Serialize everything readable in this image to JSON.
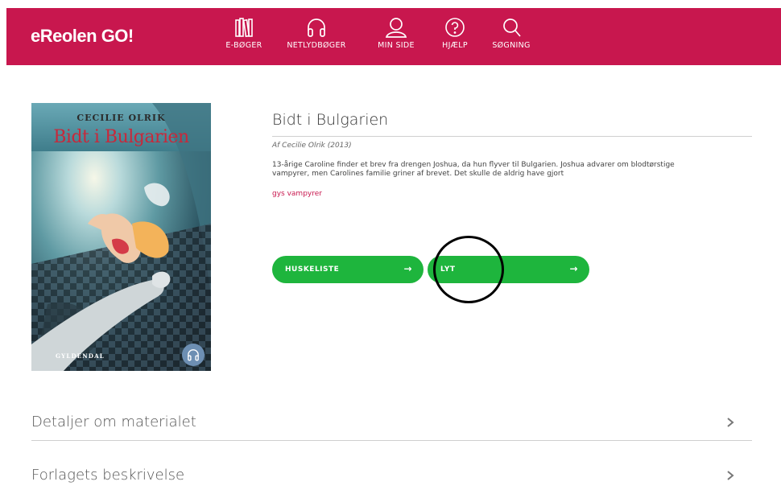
{
  "header": {
    "logo": "eReolen GO!",
    "brand_color": "#c8174e",
    "nav": [
      {
        "label": "E-BØGER",
        "icon": "books-icon"
      },
      {
        "label": "NETLYDBØGER",
        "icon": "headphones-icon"
      },
      {
        "label": "MIN SIDE",
        "icon": "user-icon"
      },
      {
        "label": "HJÆLP",
        "icon": "help-icon"
      },
      {
        "label": "SØGNING",
        "icon": "search-icon"
      }
    ]
  },
  "cover": {
    "author": "CECILIE OLRIK",
    "title": "Bidt i Bulgarien",
    "publisher": "GYLDENDAL",
    "badge_icon": "headphones-icon"
  },
  "book": {
    "title": "Bidt i Bulgarien",
    "byline": "Af Cecilie Olrik (2013)",
    "description": "13-årige Caroline finder et brev fra drengen Joshua, da hun flyver til Bulgarien. Joshua advarer om blodtørstige vampyrer, men Carolines familie griner af brevet. Det skulle de aldrig have gjort",
    "tags": "gys vampyrer"
  },
  "actions": {
    "wishlist_label": "HUSKELISTE",
    "listen_label": "LYT",
    "button_color": "#1eb53d"
  },
  "sections": [
    {
      "title": "Detaljer om materialet"
    },
    {
      "title": "Forlagets beskrivelse"
    }
  ]
}
